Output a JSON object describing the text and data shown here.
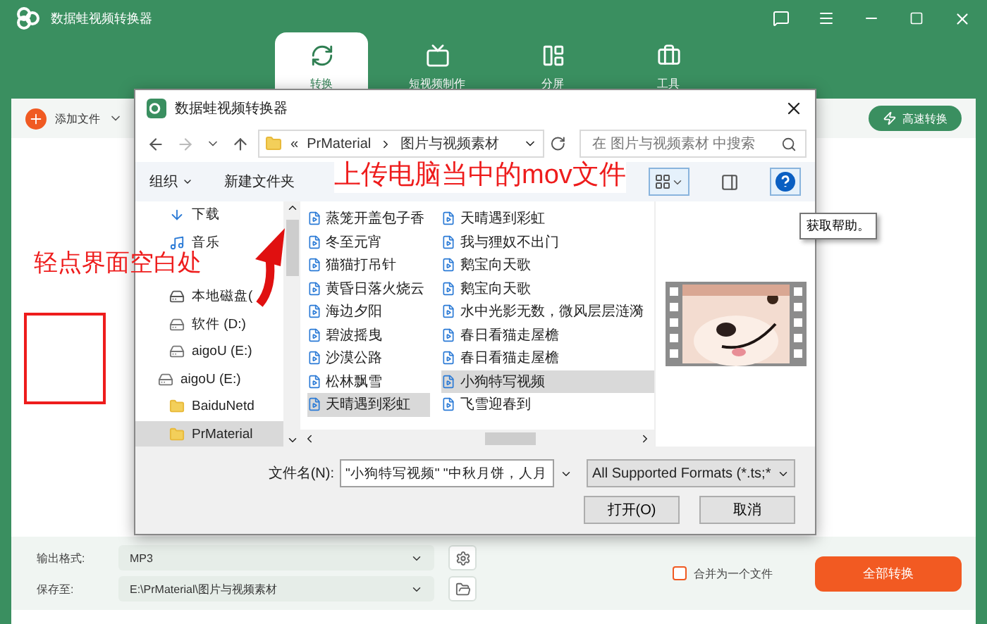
{
  "app": {
    "title": "数据蛙视频转换器"
  },
  "tabs": [
    {
      "label": "转换",
      "kind": "convert",
      "selected": true
    },
    {
      "label": "短视频制作",
      "kind": "tv",
      "selected": false
    },
    {
      "label": "分屏",
      "kind": "split",
      "selected": false
    },
    {
      "label": "工具",
      "kind": "tools",
      "selected": false
    }
  ],
  "toolbar": {
    "add_files": "添加文件",
    "fast_convert": "高速转换"
  },
  "dialog": {
    "title": "数据蛙视频转换器",
    "breadcrumb": [
      "«",
      "PrMaterial",
      "图片与视频素材"
    ],
    "search": {
      "placeholder": "在 图片与视频素材 中搜索"
    },
    "organize": "组织",
    "new_folder": "新建文件夹",
    "nav_items": [
      {
        "label": "下载",
        "kind": "download",
        "indent": true,
        "selected": false
      },
      {
        "label": "音乐",
        "kind": "music",
        "indent": true,
        "selected": false
      },
      {
        "label": "本地磁盘(",
        "kind": "windrive",
        "indent": true,
        "selected": false
      },
      {
        "label": "软件 (D:)",
        "kind": "drive",
        "indent": true,
        "selected": false
      },
      {
        "label": "aigoU (E:)",
        "kind": "drive",
        "indent": true,
        "selected": false
      },
      {
        "label": "aigoU (E:)",
        "kind": "drive",
        "indent": false,
        "selected": false
      },
      {
        "label": "BaiduNetd",
        "kind": "folder",
        "indent": true,
        "selected": false
      },
      {
        "label": "PrMaterial",
        "kind": "folder",
        "indent": true,
        "selected": true
      }
    ],
    "file_columns": [
      [
        {
          "name": "蒸笼开盖包子香",
          "selected": false
        },
        {
          "name": "冬至元宵",
          "selected": false
        },
        {
          "name": "猫猫打吊针",
          "selected": false
        },
        {
          "name": "黄昏日落火烧云",
          "selected": false
        },
        {
          "name": "海边夕阳",
          "selected": false
        },
        {
          "name": "碧波摇曳",
          "selected": false
        },
        {
          "name": "沙漠公路",
          "selected": false
        },
        {
          "name": "松林飘雪",
          "selected": false
        },
        {
          "name": "天晴遇到彩虹",
          "selected": true
        }
      ],
      [
        {
          "name": "天晴遇到彩虹",
          "selected": false
        },
        {
          "name": "我与狸奴不出门",
          "selected": false
        },
        {
          "name": "鹅宝向天歌",
          "selected": false
        },
        {
          "name": "鹅宝向天歌",
          "selected": false
        },
        {
          "name": "水中光影无数，微风层层涟漪",
          "selected": false
        },
        {
          "name": "春日看猫走屋檐",
          "selected": false
        },
        {
          "name": "春日看猫走屋檐",
          "selected": false
        },
        {
          "name": "小狗特写视频",
          "selected": true
        },
        {
          "name": "飞雪迎春到",
          "selected": false
        }
      ]
    ],
    "filename_label": "文件名(N):",
    "filename_value": "\"小狗特写视频\" \"中秋月饼，人月",
    "file_type": "All Supported Formats (*.ts;*",
    "open_button": "打开(O)",
    "cancel_button": "取消",
    "tooltip": "获取帮助。"
  },
  "annotations": [
    {
      "kind": "label",
      "text": "上传电脑当中的mov文件"
    },
    {
      "kind": "label",
      "text": "轻点界面空白处"
    },
    {
      "kind": "arrow"
    },
    {
      "kind": "box"
    }
  ],
  "bottom": {
    "format_label": "输出格式:",
    "format_value": "MP3",
    "save_label": "保存至:",
    "save_value": "E:\\PrMaterial\\图片与视频素材",
    "merge": {
      "label": "合并为一个文件",
      "checked": false
    },
    "convert_all": "全部转换"
  }
}
